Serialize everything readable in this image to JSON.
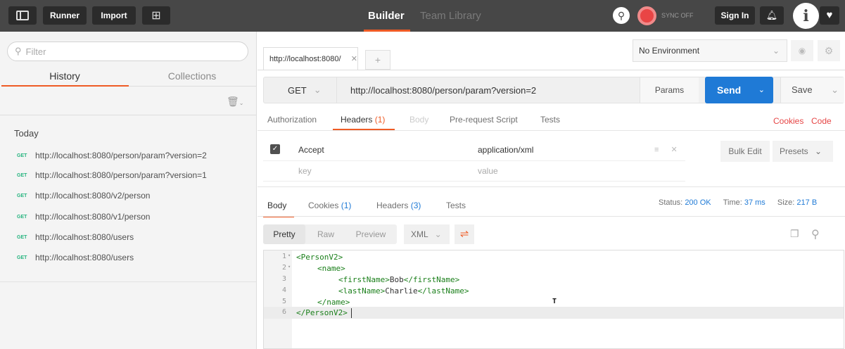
{
  "topbar": {
    "runner": "Runner",
    "import": "Import",
    "builder": "Builder",
    "team_library": "Team Library",
    "sync": "SYNC OFF",
    "sign_in": "Sign In"
  },
  "sidebar": {
    "filter_placeholder": "Filter",
    "tab_history": "History",
    "tab_collections": "Collections",
    "today": "Today",
    "items": [
      {
        "method": "GET",
        "url": "http://localhost:8080/person/param?version=2"
      },
      {
        "method": "GET",
        "url": "http://localhost:8080/person/param?version=1"
      },
      {
        "method": "GET",
        "url": "http://localhost:8080/v2/person"
      },
      {
        "method": "GET",
        "url": "http://localhost:8080/v1/person"
      },
      {
        "method": "GET",
        "url": "http://localhost:8080/users"
      },
      {
        "method": "GET",
        "url": "http://localhost:8080/users"
      }
    ]
  },
  "request": {
    "tab_title": "http://localhost:8080/",
    "environment": "No Environment",
    "method": "GET",
    "url": "http://localhost:8080/person/param?version=2",
    "params": "Params",
    "send": "Send",
    "save": "Save"
  },
  "req_tabs": {
    "authorization": "Authorization",
    "headers": "Headers",
    "headers_count": "(1)",
    "body": "Body",
    "prerequest": "Pre-request Script",
    "tests": "Tests",
    "cookies": "Cookies",
    "code": "Code"
  },
  "headers": {
    "key": "Accept",
    "value": "application/xml",
    "key_placeholder": "key",
    "value_placeholder": "value",
    "bulk_edit": "Bulk Edit",
    "presets": "Presets"
  },
  "response": {
    "body": "Body",
    "cookies": "Cookies",
    "cookies_count": "(1)",
    "headers": "Headers",
    "headers_count": "(3)",
    "tests": "Tests",
    "status_label": "Status:",
    "status": "200 OK",
    "time_label": "Time:",
    "time": "37 ms",
    "size_label": "Size:",
    "size": "217 B",
    "pretty": "Pretty",
    "raw": "Raw",
    "preview": "Preview",
    "format": "XML"
  },
  "code": {
    "lines": [
      "1",
      "2",
      "3",
      "4",
      "5",
      "6"
    ],
    "l1": "<PersonV2>",
    "l2": "<name>",
    "l3a": "<firstName>",
    "l3b": "Bob",
    "l3c": "</firstName>",
    "l4a": "<lastName>",
    "l4b": "Charlie",
    "l4c": "</lastName>",
    "l5": "</name>",
    "l6": "</PersonV2>"
  }
}
